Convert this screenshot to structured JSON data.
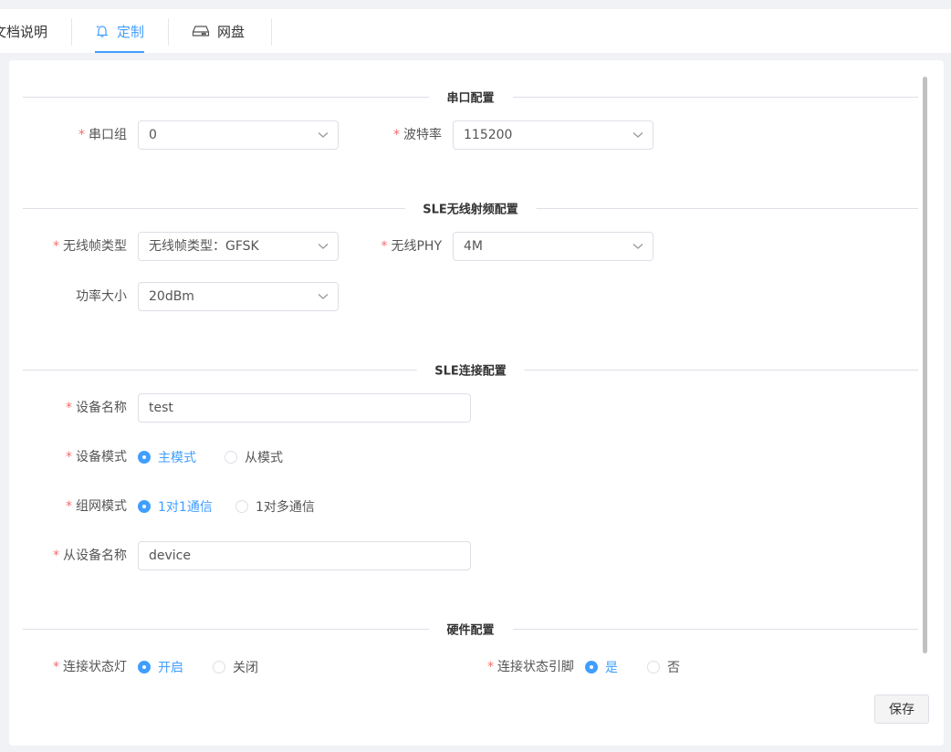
{
  "tabs": [
    {
      "label": "文档说明",
      "icon": "none",
      "active": false
    },
    {
      "label": "定制",
      "icon": "bell-icon",
      "active": true
    },
    {
      "label": "网盘",
      "icon": "hard-drive-icon",
      "active": false
    }
  ],
  "accent_color": "#409eff",
  "required_color": "#f56c6c",
  "sections": {
    "serial": {
      "title": "串口配置",
      "group": {
        "label": "串口组",
        "value": "0"
      },
      "baud": {
        "label": "波特率",
        "value": "115200"
      }
    },
    "rf": {
      "title": "SLE无线射频配置",
      "frame_type": {
        "label": "无线帧类型",
        "value": "无线帧类型：GFSK"
      },
      "phy": {
        "label": "无线PHY",
        "value": "4M"
      },
      "power": {
        "label": "功率大小",
        "value": "20dBm"
      }
    },
    "conn": {
      "title": "SLE连接配置",
      "device_name": {
        "label": "设备名称",
        "value": "test"
      },
      "device_mode": {
        "label": "设备模式",
        "options": [
          "主模式",
          "从模式"
        ],
        "selected": "主模式"
      },
      "network_mode": {
        "label": "组网模式",
        "options": [
          "1对1通信",
          "1对多通信"
        ],
        "selected": "1对1通信"
      },
      "slave_name": {
        "label": "从设备名称",
        "value": "device"
      }
    },
    "hw": {
      "title": "硬件配置",
      "status_led": {
        "label": "连接状态灯",
        "options": [
          "开启",
          "关闭"
        ],
        "selected": "开启"
      },
      "status_pin": {
        "label": "连接状态引脚",
        "options": [
          "是",
          "否"
        ],
        "selected": "是"
      }
    }
  },
  "save_label": "保存"
}
